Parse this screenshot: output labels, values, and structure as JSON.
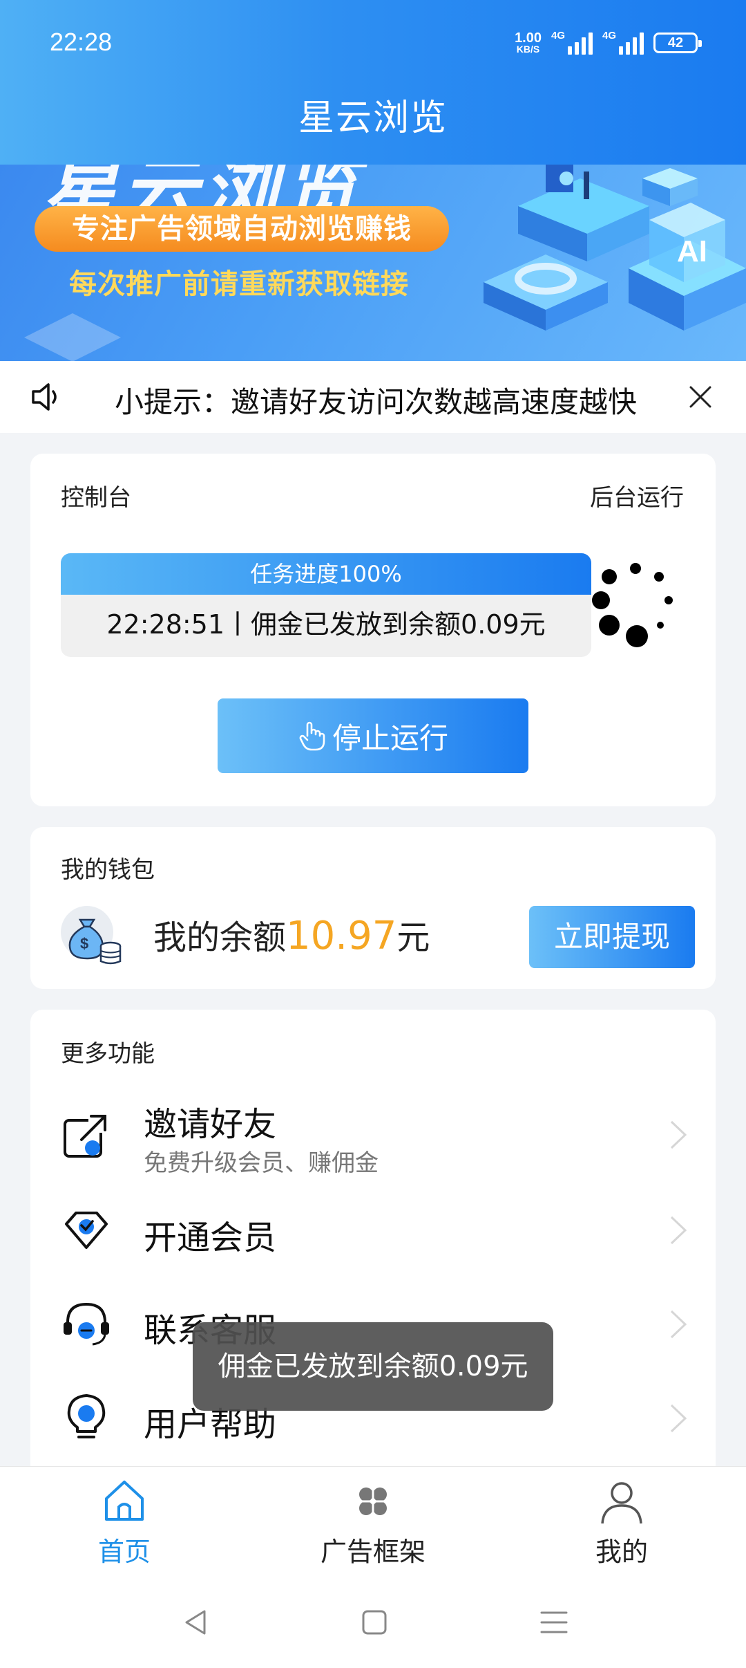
{
  "status_bar": {
    "time": "22:28",
    "net_speed_value": "1.00",
    "net_speed_unit": "KB/S",
    "signal1_tag": "4G",
    "signal2_tag": "4G",
    "battery": "42"
  },
  "header": {
    "title": "星云浏览"
  },
  "banner": {
    "big_text": "星云浏览",
    "pill_text": "专注广告领域自动浏览赚钱",
    "sub_text": "每次推广前请重新获取链接",
    "art_label": "AI"
  },
  "notice": {
    "text": "小提示：邀请好友访问次数越高速度越快"
  },
  "console": {
    "title": "控制台",
    "background_run": "后台运行",
    "progress_label": "任务进度100%",
    "progress_value": 1.0,
    "message": "22:28:51丨佣金已发放到余额0.09元",
    "stop_button": "停止运行"
  },
  "wallet": {
    "title": "我的钱包",
    "balance_prefix": "我的余额",
    "balance_amount": "10.97",
    "balance_unit": "元",
    "withdraw_button": "立即提现"
  },
  "more": {
    "title": "更多功能",
    "items": [
      {
        "label": "邀请好友",
        "sub": "免费升级会员、赚佣金",
        "icon": "share-icon"
      },
      {
        "label": "开通会员",
        "sub": "",
        "icon": "vip-diamond-icon"
      },
      {
        "label": "联系客服",
        "sub": "",
        "icon": "headset-icon"
      },
      {
        "label": "用户帮助",
        "sub": "",
        "icon": "lightbulb-icon"
      }
    ]
  },
  "toast": {
    "text": "佣金已发放到余额0.09元"
  },
  "bottom_nav": {
    "items": [
      {
        "label": "首页",
        "icon": "home-icon",
        "active": true
      },
      {
        "label": "广告框架",
        "icon": "grid-icon",
        "active": false
      },
      {
        "label": "我的",
        "icon": "user-icon",
        "active": false
      }
    ]
  },
  "colors": {
    "primary": "#1a7bf0",
    "primary_light": "#5ab8f6",
    "accent_orange": "#f5a623",
    "active_tab": "#1e90e8"
  }
}
